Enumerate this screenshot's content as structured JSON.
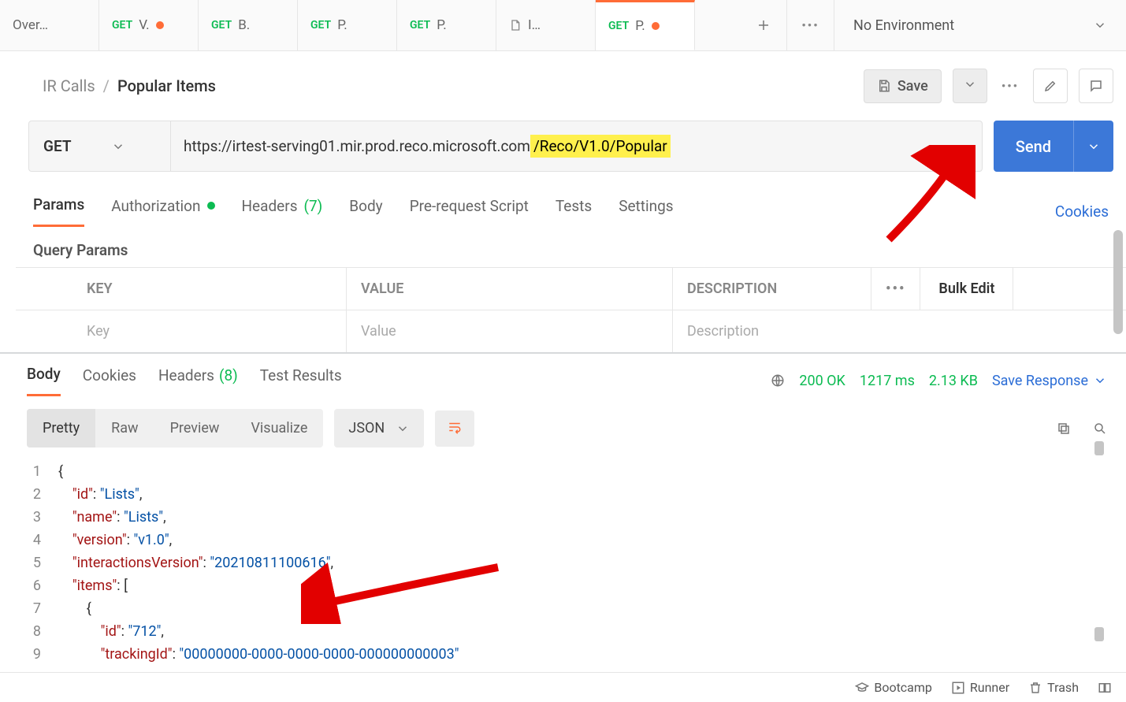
{
  "tabs": [
    {
      "label": "Over…",
      "method": "",
      "hasDot": false,
      "icon": false
    },
    {
      "label": "V.",
      "method": "GET",
      "hasDot": true,
      "icon": false
    },
    {
      "label": "B.",
      "method": "GET",
      "hasDot": false,
      "icon": false
    },
    {
      "label": "P.",
      "method": "GET",
      "hasDot": false,
      "icon": false
    },
    {
      "label": "P.",
      "method": "GET",
      "hasDot": false,
      "icon": false
    },
    {
      "label": "I…",
      "method": "",
      "hasDot": false,
      "icon": true
    },
    {
      "label": "P.",
      "method": "GET",
      "hasDot": true,
      "icon": false
    }
  ],
  "environment": {
    "selected": "No Environment"
  },
  "breadcrumb": {
    "collection": "IR Calls",
    "sep": "/",
    "request": "Popular Items"
  },
  "actions": {
    "save": "Save"
  },
  "request": {
    "method": "GET",
    "url_plain": "https://irtest-serving01.mir.prod.reco.microsoft.com",
    "url_highlight": "/Reco/V1.0/Popular",
    "send": "Send"
  },
  "reqTabs": {
    "params": "Params",
    "auth": "Authorization",
    "headers": "Headers",
    "headersCount": "(7)",
    "body": "Body",
    "prereq": "Pre-request Script",
    "tests": "Tests",
    "settings": "Settings",
    "cookies": "Cookies"
  },
  "queryParamsHeading": "Query Params",
  "paramsTable": {
    "headers": {
      "key": "KEY",
      "value": "VALUE",
      "desc": "DESCRIPTION",
      "bulk": "Bulk Edit"
    },
    "placeholders": {
      "key": "Key",
      "value": "Value",
      "desc": "Description"
    }
  },
  "respTabs": {
    "body": "Body",
    "cookies": "Cookies",
    "headers": "Headers",
    "headersCount": "(8)",
    "tests": "Test Results"
  },
  "respMeta": {
    "status": "200 OK",
    "time": "1217 ms",
    "size": "2.13 KB",
    "saveResponse": "Save Response"
  },
  "bodyViews": {
    "pretty": "Pretty",
    "raw": "Raw",
    "preview": "Preview",
    "visualize": "Visualize",
    "format": "JSON"
  },
  "json": {
    "lines": [
      {
        "n": 1,
        "indent": 0,
        "tokens": [
          [
            "punct",
            "{"
          ]
        ]
      },
      {
        "n": 2,
        "indent": 1,
        "tokens": [
          [
            "key",
            "\"id\""
          ],
          [
            "punct",
            ": "
          ],
          [
            "str",
            "\"Lists\""
          ],
          [
            "punct",
            ","
          ]
        ]
      },
      {
        "n": 3,
        "indent": 1,
        "tokens": [
          [
            "key",
            "\"name\""
          ],
          [
            "punct",
            ": "
          ],
          [
            "str",
            "\"Lists\""
          ],
          [
            "punct",
            ","
          ]
        ]
      },
      {
        "n": 4,
        "indent": 1,
        "tokens": [
          [
            "key",
            "\"version\""
          ],
          [
            "punct",
            ": "
          ],
          [
            "str",
            "\"v1.0\""
          ],
          [
            "punct",
            ","
          ]
        ]
      },
      {
        "n": 5,
        "indent": 1,
        "tokens": [
          [
            "key",
            "\"interactionsVersion\""
          ],
          [
            "punct",
            ": "
          ],
          [
            "str",
            "\"20210811100616\""
          ],
          [
            "punct",
            ","
          ]
        ]
      },
      {
        "n": 6,
        "indent": 1,
        "tokens": [
          [
            "key",
            "\"items\""
          ],
          [
            "punct",
            ": ["
          ]
        ]
      },
      {
        "n": 7,
        "indent": 2,
        "tokens": [
          [
            "punct",
            "{"
          ]
        ]
      },
      {
        "n": 8,
        "indent": 3,
        "tokens": [
          [
            "key",
            "\"id\""
          ],
          [
            "punct",
            ": "
          ],
          [
            "str",
            "\"712\""
          ],
          [
            "punct",
            ","
          ]
        ]
      },
      {
        "n": 9,
        "indent": 3,
        "tokens": [
          [
            "key",
            "\"trackingId\""
          ],
          [
            "punct",
            ": "
          ],
          [
            "str",
            "\"00000000-0000-0000-0000-000000000003\""
          ]
        ]
      }
    ]
  },
  "footer": {
    "bootcamp": "Bootcamp",
    "runner": "Runner",
    "trash": "Trash"
  }
}
